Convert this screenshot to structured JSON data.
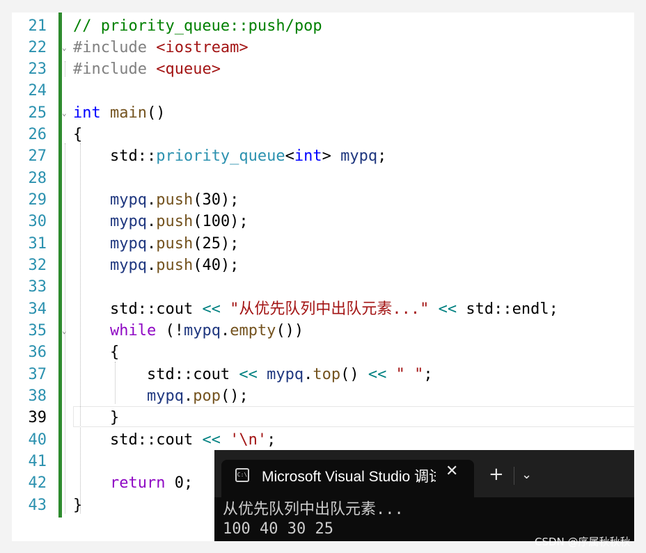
{
  "editor": {
    "line_numbers": [
      "21",
      "22",
      "23",
      "24",
      "25",
      "26",
      "27",
      "28",
      "29",
      "30",
      "31",
      "32",
      "33",
      "34",
      "35",
      "36",
      "37",
      "38",
      "39",
      "40",
      "41",
      "42",
      "43"
    ],
    "current_line": "39",
    "code": {
      "l21": {
        "comment": "// priority_queue::push/pop"
      },
      "l22": {
        "directive": "#include ",
        "header": "<iostream>"
      },
      "l23": {
        "directive": "#include ",
        "header": "<queue>"
      },
      "l25": {
        "type": "int",
        "fn": "main",
        "paren": "()"
      },
      "l26": {
        "brace": "{"
      },
      "l27": {
        "ns": "std::",
        "type": "priority_queue",
        "lt": "<",
        "targ": "int",
        "gt": ">",
        "var": " mypq",
        "end": ";"
      },
      "l29": {
        "var": "mypq",
        "dot": ".",
        "fn": "push",
        "args": "(30);"
      },
      "l30": {
        "var": "mypq",
        "dot": ".",
        "fn": "push",
        "args": "(100);"
      },
      "l31": {
        "var": "mypq",
        "dot": ".",
        "fn": "push",
        "args": "(25);"
      },
      "l32": {
        "var": "mypq",
        "dot": ".",
        "fn": "push",
        "args": "(40);"
      },
      "l34": {
        "ns": "std::cout ",
        "op": "<<",
        "str": " \"从优先队列中出队元素...\" ",
        "op2": "<<",
        "tail": " std::endl;"
      },
      "l35": {
        "kw": "while",
        "open": " (!",
        "var": "mypq",
        "dot": ".",
        "fn": "empty",
        "close": "())"
      },
      "l36": {
        "brace": "{"
      },
      "l37": {
        "ns": "std::cout ",
        "op": "<<",
        "var": " mypq",
        "dot": ".",
        "fn": "top",
        "paren": "() ",
        "op2": "<<",
        "str": " \" \"",
        "end": ";"
      },
      "l38": {
        "var": "mypq",
        "dot": ".",
        "fn": "pop",
        "args": "();"
      },
      "l39": {
        "brace": "}"
      },
      "l40": {
        "ns": "std::cout ",
        "op": "<<",
        "str": " '\\n'",
        "end": ";"
      },
      "l42": {
        "kw": "return",
        "tail": " 0;"
      },
      "l43": {
        "brace": "}"
      }
    },
    "fold_marker": "⌄"
  },
  "terminal": {
    "tab_title": "Microsoft Visual Studio 调试控制台",
    "tab_icon": "C:\\",
    "close_glyph": "✕",
    "new_tab_glyph": "+",
    "dropdown_glyph": "⌄",
    "output": [
      "从优先队列中出队元素...",
      "100 40 30 25"
    ]
  },
  "watermark": "CSDN @序属秋秋秋",
  "icons": {
    "tab_icon": "terminal-icon",
    "close": "close-icon",
    "new_tab": "plus-icon",
    "dropdown": "chevron-down-icon"
  },
  "colors": {
    "change_bar": "#2e8b2e",
    "keyword": "#0000ff",
    "control_keyword": "#8f08c4",
    "string": "#a31515",
    "terminal_bg": "#0c0c0c"
  }
}
